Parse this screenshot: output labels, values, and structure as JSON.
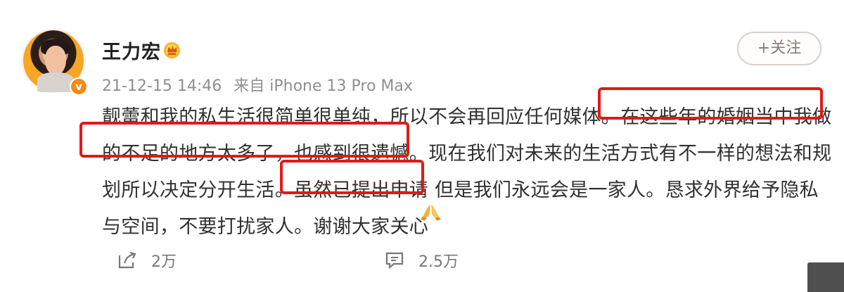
{
  "author": {
    "name": "王力宏",
    "verified_icon": "verified-badge-icon",
    "membership_icon": "crown-icon"
  },
  "meta": {
    "timestamp": "21-12-15 14:46",
    "source": "来自 iPhone 13 Pro Max"
  },
  "actions": {
    "follow_label": "+关注",
    "share_count": "2万",
    "comment_count": "2.5万"
  },
  "post": {
    "lines": [
      "靓蕾和我的私生活很简单很单纯，所以不会再回应任何媒体。在这些年的婚姻当中我做",
      "的不足的地方太多了，也感到很遗憾。现在我们对未来的生活方式有不一样的想法和规",
      "划所以决定分开生活。虽然已提出申请  但是我们永远会是一家人。恳求外界给予隐私",
      "与空间，不要打扰家人。谢谢大家关心"
    ],
    "emoji_icon": "praying-hands-icon"
  },
  "colors": {
    "highlight": "#df1a1a",
    "verified": "#f48a18",
    "text": "#303030",
    "meta": "#8f8f8f"
  }
}
